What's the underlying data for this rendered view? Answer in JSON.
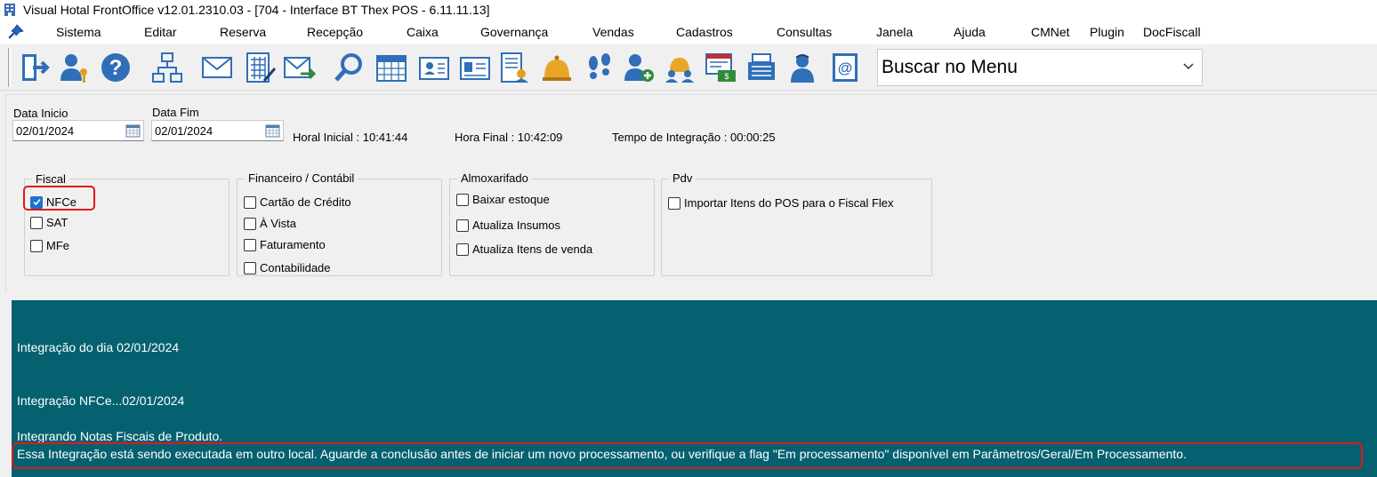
{
  "window": {
    "title": "Visual Hotal FrontOffice v12.01.2310.03 - [704 - Interface BT Thex POS - 6.11.11.13]"
  },
  "menu": {
    "items": [
      "Sistema",
      "Editar",
      "Reserva",
      "Recepção",
      "Caixa",
      "Governança",
      "Vendas",
      "Cadastros",
      "Consultas",
      "Janela",
      "Ajuda",
      "CMNet",
      "Plugin",
      "DocFiscall"
    ]
  },
  "toolbar": {
    "icons": [
      "exit-icon",
      "user-key-icon",
      "help-icon",
      "network-icon",
      "mail-icon",
      "calculator-icon",
      "mail-send-icon",
      "search-icon",
      "calendar-icon",
      "guest-card-icon",
      "id-card-icon",
      "guest-list-icon",
      "bell-icon",
      "footprints-icon",
      "add-user-icon",
      "group-bell-icon",
      "invoice-icon",
      "cash-register-icon",
      "receptionist-icon",
      "email-book-icon"
    ],
    "search_value": "Buscar no Menu"
  },
  "form": {
    "data_inicio_label": "Data Inicio",
    "data_inicio_value": "02/01/2024",
    "data_fim_label": "Data Fim",
    "data_fim_value": "02/01/2024",
    "hora_inicial": "Horal Inicial : 10:41:44",
    "hora_final": "Hora Final : 10:42:09",
    "tempo": "Tempo de Integração :  00:00:25"
  },
  "groups": {
    "fiscal": {
      "title": "Fiscal",
      "items": [
        {
          "label": "NFCe",
          "checked": true
        },
        {
          "label": "SAT",
          "checked": false
        },
        {
          "label": "MFe",
          "checked": false
        }
      ]
    },
    "financeiro": {
      "title": "Financeiro / Contábil",
      "items": [
        {
          "label": "Cartão de Crédito",
          "checked": false
        },
        {
          "label": "À Vista",
          "checked": false
        },
        {
          "label": "Faturamento",
          "checked": false
        },
        {
          "label": "Contabilidade",
          "checked": false
        }
      ]
    },
    "almoxarifado": {
      "title": "Almoxarifado",
      "items": [
        {
          "label": "Baixar estoque",
          "checked": false
        },
        {
          "label": "Atualiza Insumos",
          "checked": false
        },
        {
          "label": "Atualiza Itens de venda",
          "checked": false
        }
      ]
    },
    "pdv": {
      "title": "Pdv",
      "items": [
        {
          "label": "Importar Itens do POS para o Fiscal Flex",
          "checked": false
        }
      ]
    }
  },
  "log": {
    "lines": [
      "Integração do dia 02/01/2024",
      "Integração NFCe...02/01/2024",
      "Integrando Notas Fiscais de Produto.",
      "Essa Integração está sendo executada em outro local. Aguarde a conclusão antes de iniciar um novo processamento, ou verifique a flag \"Em processamento\" disponível em Parâmetros/Geral/Em Processamento."
    ]
  },
  "colors": {
    "log_background": "#056170",
    "highlight": "#e01818",
    "checkbox_checked": "#1f6fcf"
  }
}
